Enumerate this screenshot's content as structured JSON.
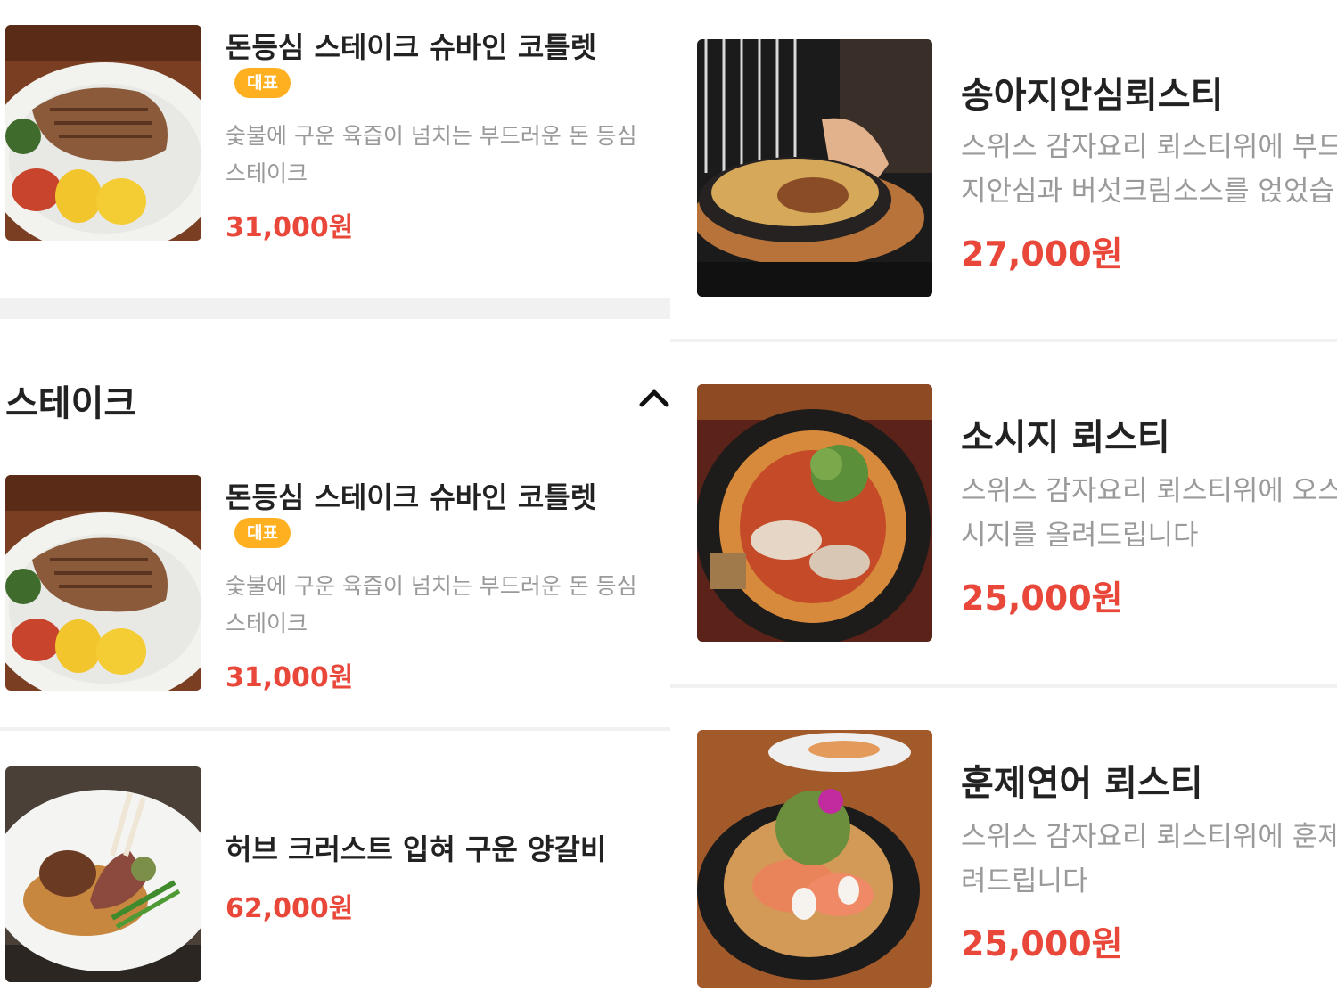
{
  "left": {
    "items": [
      {
        "name": "돈등심 스테이크 슈바인 코틀렛",
        "badge": "대표",
        "desc_line1": "숯불에 구운 육즙이 넘치는 부드러운 돈 등심",
        "desc_line2": "스테이크",
        "price": "31,000원"
      },
      {
        "name": "돈등심 스테이크 슈바인 코틀렛",
        "badge": "대표",
        "desc_line1": "숯불에 구운 육즙이 넘치는 부드러운 돈 등심",
        "desc_line2": "스테이크",
        "price": "31,000원"
      },
      {
        "name": "허브 크러스트 입혀 구운 양갈비",
        "price": "62,000원"
      }
    ],
    "section": {
      "title": "스테이크",
      "toggle_icon": "chevron-up-icon"
    }
  },
  "right": {
    "items": [
      {
        "name": "송아지안심뢰스티",
        "desc_line1": "스위스 감자요리 뢰스티위에 부드",
        "desc_line2": "지안심과 버섯크림소스를 얹었습",
        "price": "27,000원"
      },
      {
        "name": "소시지 뢰스티",
        "desc_line1": "스위스 감자요리 뢰스티위에 오스",
        "desc_line2": "시지를 올려드립니다",
        "price": "25,000원"
      },
      {
        "name": "훈제연어 뢰스티",
        "desc_line1": "스위스 감자요리 뢰스티위에 훈제",
        "desc_line2": "려드립니다",
        "price": "25,000원"
      }
    ]
  },
  "colors": {
    "price": "#e8473a",
    "badge": "#ffb020",
    "divider": "#f1f1f1"
  }
}
